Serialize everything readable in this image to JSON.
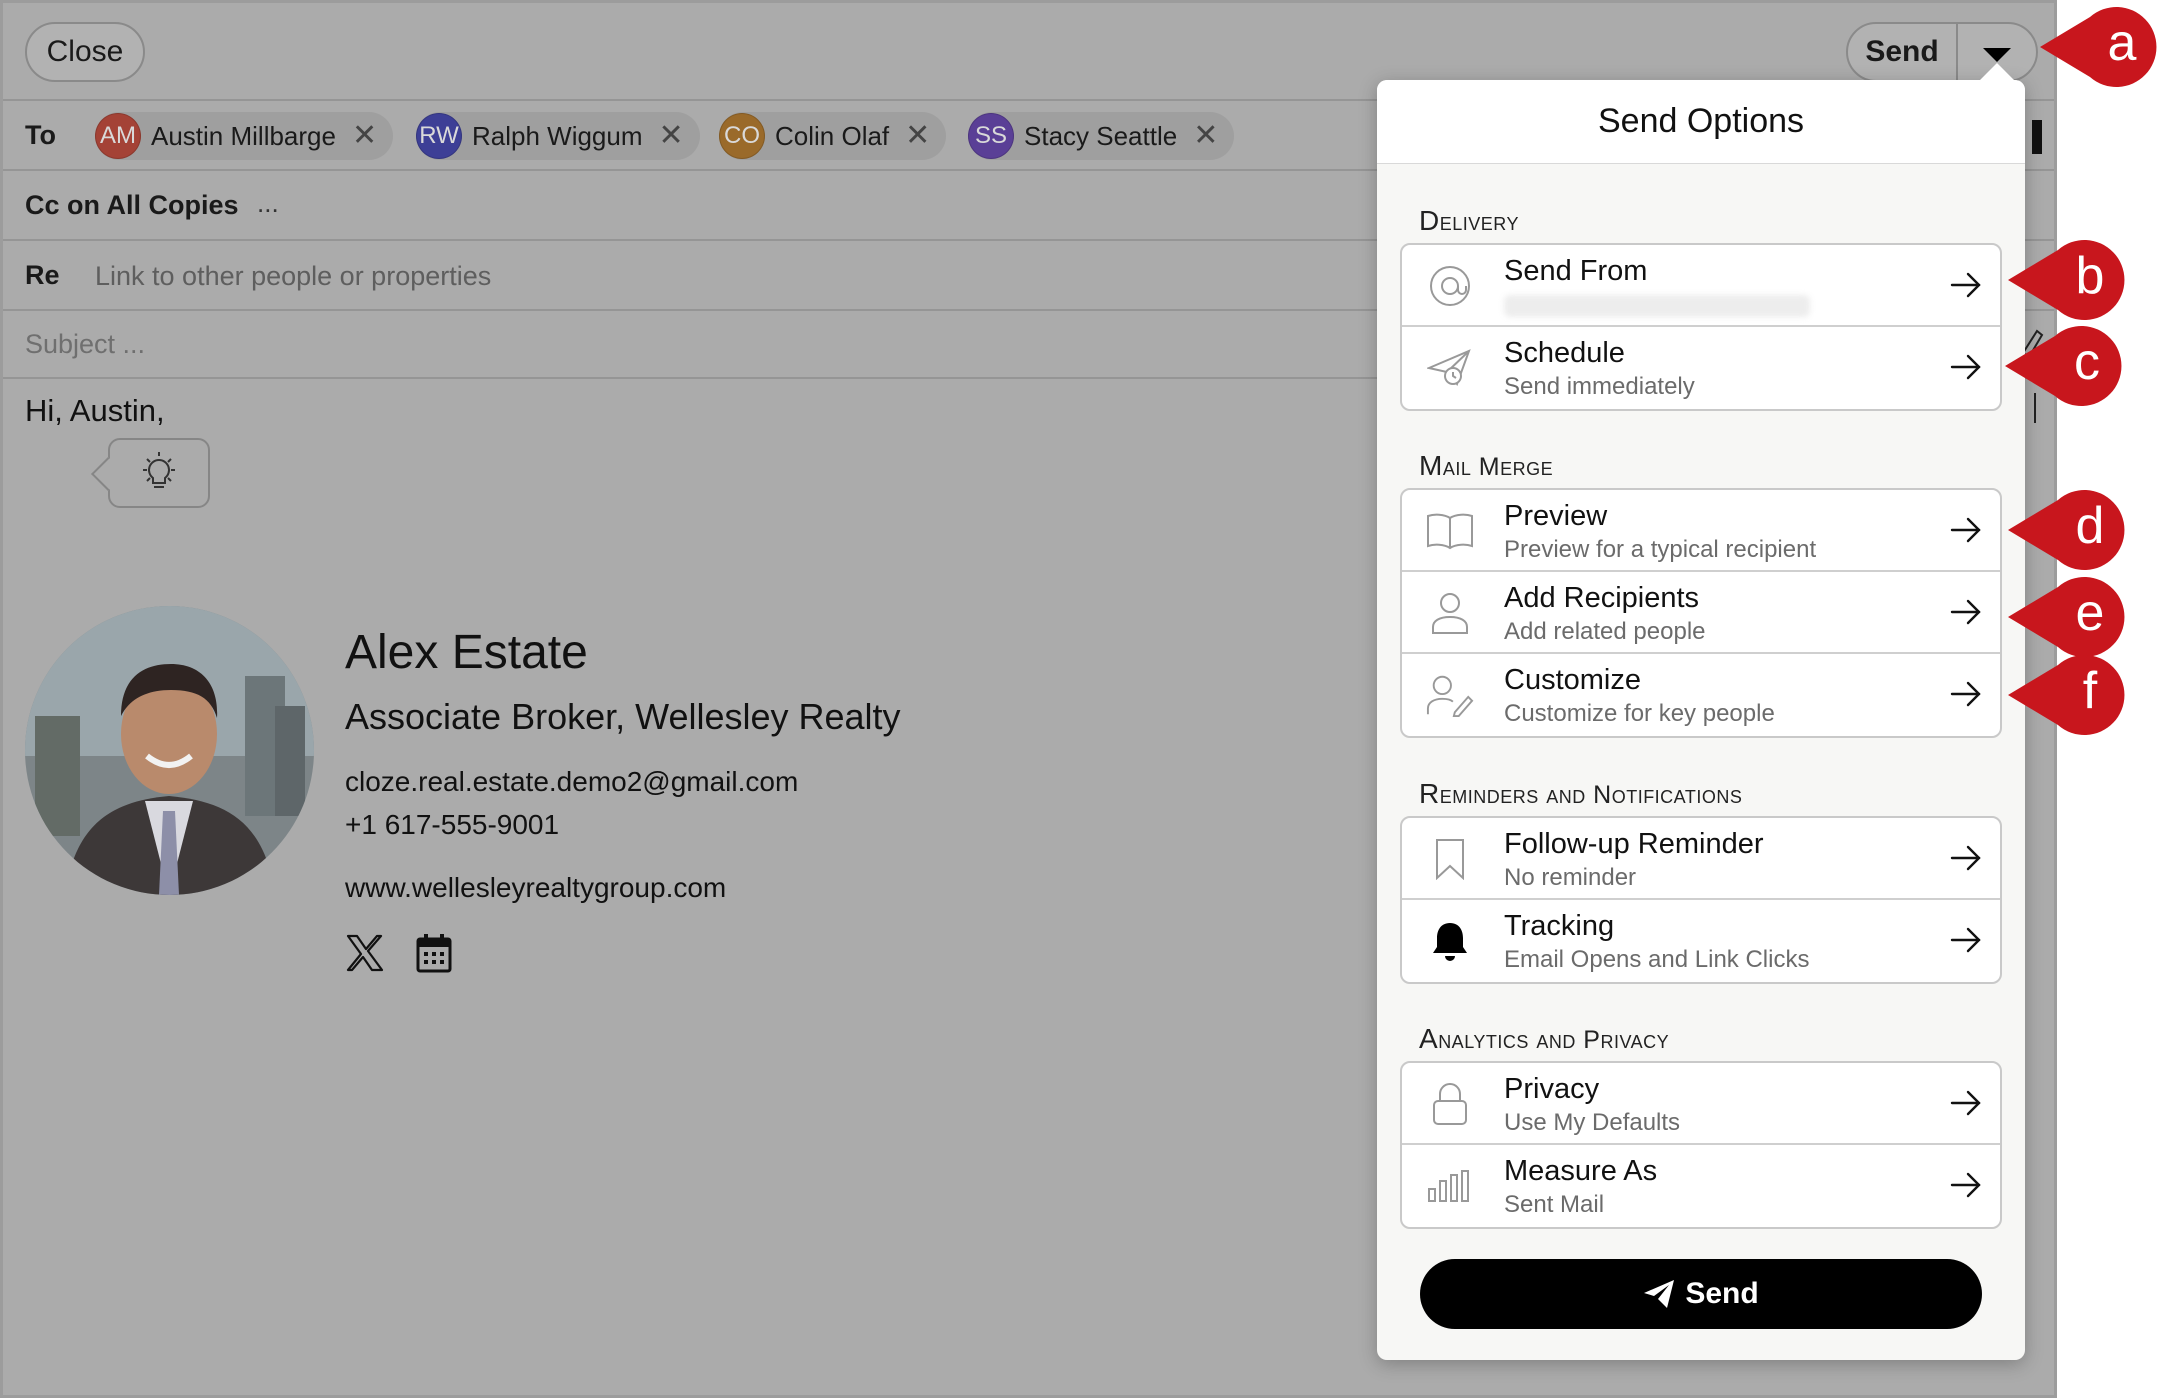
{
  "compose": {
    "close_label": "Close",
    "send_label": "Send",
    "to_label": "To",
    "recipients": [
      {
        "initials": "AM",
        "name": "Austin Millbarge",
        "color": "#a44236"
      },
      {
        "initials": "RW",
        "name": "Ralph Wiggum",
        "color": "#3d3f96"
      },
      {
        "initials": "CO",
        "name": "Colin Olaf",
        "color": "#9a6a2a"
      },
      {
        "initials": "SS",
        "name": "Stacy Seattle",
        "color": "#5a3f96"
      }
    ],
    "cc_label": "Cc on All Copies",
    "cc_more": "...",
    "re_label": "Re",
    "re_placeholder": "Link to other people or properties",
    "subject_placeholder": "Subject ...",
    "greeting": "Hi, Austin,"
  },
  "signature": {
    "name": "Alex Estate",
    "title": "Associate Broker, Wellesley Realty",
    "email": "cloze.real.estate.demo2@gmail.com",
    "phone": "+1 617-555-9001",
    "website": "www.wellesleyrealtygroup.com",
    "icons": [
      "x-logo-icon",
      "calendar-icon"
    ]
  },
  "send_options": {
    "title": "Send Options",
    "sections": [
      {
        "heading": "Delivery",
        "items": [
          {
            "icon": "at-sign-icon",
            "title": "Send From",
            "subtitle": ""
          },
          {
            "icon": "paper-plane-clock-icon",
            "title": "Schedule",
            "subtitle": "Send immediately"
          }
        ]
      },
      {
        "heading": "Mail Merge",
        "items": [
          {
            "icon": "book-open-icon",
            "title": "Preview",
            "subtitle": "Preview for a typical recipient"
          },
          {
            "icon": "person-icon",
            "title": "Add Recipients",
            "subtitle": "Add related people"
          },
          {
            "icon": "person-edit-icon",
            "title": "Customize",
            "subtitle": "Customize for key people"
          }
        ]
      },
      {
        "heading": "Reminders and Notifications",
        "items": [
          {
            "icon": "bookmark-icon",
            "title": "Follow-up Reminder",
            "subtitle": "No reminder"
          },
          {
            "icon": "bell-icon",
            "title": "Tracking",
            "subtitle": "Email Opens and Link Clicks"
          }
        ]
      },
      {
        "heading": "Analytics and Privacy",
        "items": [
          {
            "icon": "lock-icon",
            "title": "Privacy",
            "subtitle": "Use My Defaults"
          },
          {
            "icon": "bar-chart-icon",
            "title": "Measure As",
            "subtitle": "Sent Mail"
          }
        ]
      }
    ],
    "send_button": "Send"
  },
  "annotations": [
    "a",
    "b",
    "c",
    "d",
    "e",
    "f"
  ],
  "colors": {
    "marker": "#c8161d",
    "overlay": "#ababab",
    "send_button": "#000000"
  }
}
